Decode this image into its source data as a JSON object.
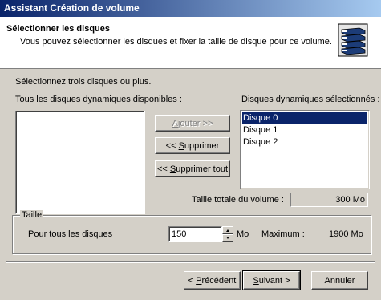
{
  "window": {
    "title": "Assistant Création de volume"
  },
  "header": {
    "title": "Sélectionner les disques",
    "subtitle": "Vous pouvez sélectionner les disques et fixer la taille de disque pour ce volume.",
    "icon": "disk-stack-icon"
  },
  "instructions": "Sélectionnez trois disques ou plus.",
  "available": {
    "label": "Tous les disques dynamiques disponibles :",
    "items": []
  },
  "selected": {
    "label": "Disques dynamiques sélectionnés :",
    "items": [
      "Disque 0",
      "Disque 1",
      "Disque 2"
    ]
  },
  "buttons": {
    "add": "Ajouter >>",
    "remove": "<< Supprimer",
    "remove_all": "<< Supprimer tout"
  },
  "total": {
    "label": "Taille totale du volume :",
    "value": "300 Mo"
  },
  "size_group": {
    "legend": "Taille",
    "field_label": "Pour tous les disques",
    "value": "150",
    "unit": "Mo",
    "max_label": "Maximum :",
    "max_value": "1900 Mo"
  },
  "footer": {
    "back": "< Précédent",
    "next": "Suivant >",
    "cancel": "Annuler"
  },
  "colors": {
    "titlebar_start": "#0a246a",
    "titlebar_end": "#a6caf0",
    "selection": "#0a246a"
  }
}
